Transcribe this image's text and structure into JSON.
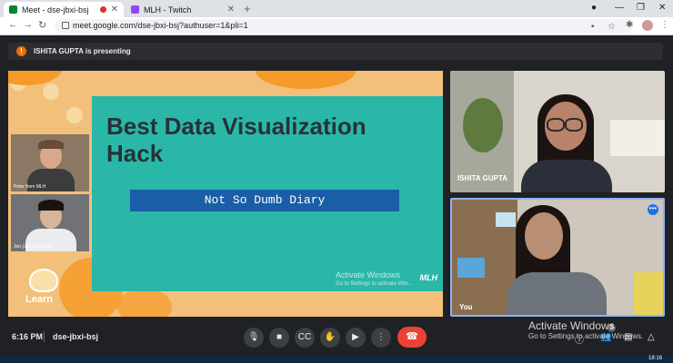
{
  "browser": {
    "tabs": [
      {
        "title": "Meet - dse-jbxi-bsj",
        "active": true
      },
      {
        "title": "MLH - Twitch",
        "active": false
      }
    ],
    "url": "meet.google.com/dse-jbxi-bsj?authuser=1&pli=1"
  },
  "banner": {
    "text": "ISHITA GUPTA is presenting",
    "icon": "info-icon"
  },
  "slide": {
    "title": "Best Data Visualization Hack",
    "subtitle": "Not So Dumb Diary",
    "watermark_title": "Activate Windows",
    "watermark_sub": "Go to Settings to activate Win...",
    "brand": "MLH",
    "logo_text": "Learn",
    "cams": [
      {
        "name": "Peter from MLH"
      },
      {
        "name": "Jon (Jeff Kingsley)"
      }
    ]
  },
  "participants": [
    {
      "name": "ISHITA GUPTA"
    },
    {
      "name": "You"
    }
  ],
  "bottom": {
    "time": "6:16 PM",
    "meeting_code": "dse-jbxi-bsj",
    "participant_count": "3"
  },
  "windows_overlay": {
    "title": "Activate Windows",
    "sub": "Go to Settings to activate Windows."
  },
  "taskbar": {
    "clock": "18:16"
  },
  "colors": {
    "slide_bg": "#2bb7a8",
    "slide_sub_bg": "#1a5ea8",
    "end_call": "#ea4335",
    "presenting_icon": "#e8710a",
    "active_speaker_border": "#8ab4f8"
  }
}
